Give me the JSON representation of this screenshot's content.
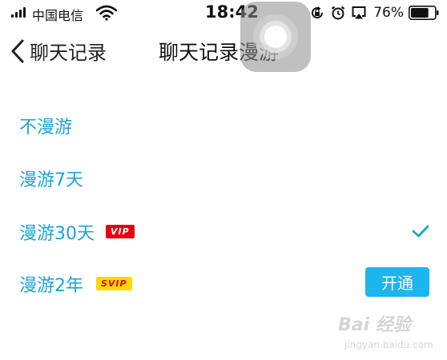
{
  "status_bar": {
    "carrier": "中国电信",
    "time": "18:42",
    "battery_percent": "76%",
    "battery_level": 0.76,
    "icons": [
      "signal-icon",
      "wifi-icon",
      "orientation-lock-icon",
      "alarm-icon",
      "airplay-icon",
      "battery-icon"
    ]
  },
  "nav": {
    "back_label": "聊天记录",
    "title": "聊天记录漫游"
  },
  "options": [
    {
      "label": "不漫游"
    },
    {
      "label": "漫游7天"
    },
    {
      "label": "漫游30天",
      "badge": "VIP",
      "selected": true
    },
    {
      "label": "漫游2年",
      "badge": "SVIP",
      "action": "开通"
    }
  ],
  "watermark": {
    "brand": "Bai 经验",
    "url": "jingyan.baidu.com"
  },
  "colors": {
    "accent": "#1aa6d6",
    "button": "#1db5ee",
    "vip_badge": "#e60012",
    "svip_badge": "#ffd800"
  }
}
